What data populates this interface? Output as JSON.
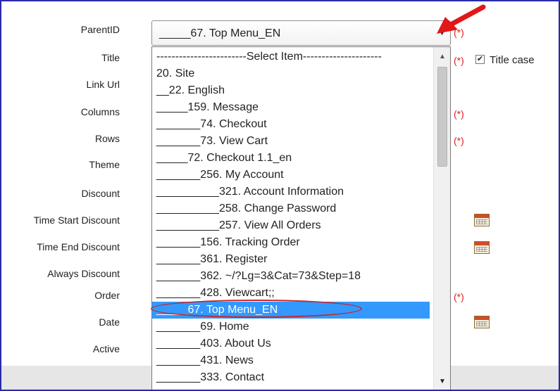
{
  "labels": {
    "parent_id": "ParentID",
    "title": "Title",
    "link_url": "Link Url",
    "columns": "Columns",
    "rows": "Rows",
    "theme": "Theme",
    "discount": "Discount",
    "time_start_discount": "Time Start Discount",
    "time_end_discount": "Time End Discount",
    "always_discount": "Always Discount",
    "order": "Order",
    "date": "Date",
    "active": "Active"
  },
  "required_marker": "(*)",
  "title_case": {
    "label": "Title case",
    "checked": true,
    "check_glyph": "✔"
  },
  "parent_select": {
    "value": "_____67. Top Menu_EN",
    "caret": "▼",
    "options": [
      "------------------------Select Item---------------------",
      "20. Site",
      "__22. English",
      "_____159. Message",
      "_______74. Checkout",
      "_______73. View Cart",
      "_____72. Checkout 1.1_en",
      "_______256. My Account",
      "__________321. Account Information",
      "__________258. Change Password",
      "__________257. View All Orders",
      "_______156. Tracking Order",
      "_______361. Register",
      "_______362. ~/?Lg=3&Cat=73&Step=18",
      "_______428. Viewcart;;",
      "_____67. Top Menu_EN",
      "_______69. Home",
      "_______403. About Us",
      "_______431. News",
      "_______333. Contact"
    ],
    "selected_index": 15,
    "scroll_up": "▲",
    "scroll_down": "▼"
  },
  "icons": {
    "calendar": "calendar-icon",
    "annotation_arrow": "red-arrow-icon",
    "annotation_ellipse": "red-ellipse-highlight"
  },
  "colors": {
    "selection": "#3399ff",
    "required": "#e02020",
    "frame": "#2a2aa8",
    "annotation": "#e01818"
  }
}
